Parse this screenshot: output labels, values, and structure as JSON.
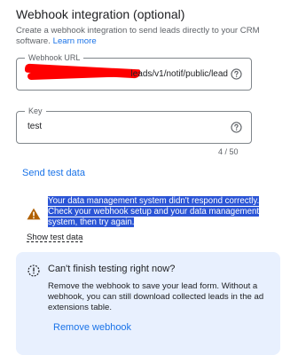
{
  "section": {
    "title": "Webhook integration (optional)",
    "description": "Create a webhook integration to send leads directly to your CRM software.",
    "learn_more": "Learn more"
  },
  "webhook_url": {
    "label": "Webhook URL",
    "value_visible_suffix": "leads/v1/notif/public/lead",
    "help_icon": "help-circle-icon"
  },
  "key": {
    "label": "Key",
    "value": "test",
    "counter": "4 / 50",
    "help_icon": "help-circle-icon"
  },
  "send_test_label": "Send test data",
  "warning": {
    "icon": "warning-triangle-icon",
    "message": "Your data management system didn't respond correctly. Check your webhook setup and your data management system, then try again.",
    "show_test_label": "Show test data"
  },
  "info_card": {
    "icon": "info-dashed-icon",
    "title": "Can't finish testing right now?",
    "body": "Remove the webhook to save your lead form. Without a webhook, you can still download collected leads in the ad extensions table.",
    "remove_label": "Remove webhook"
  },
  "colors": {
    "accent": "#1a73e8",
    "warning": "#b06000",
    "selection": "#2b55d6",
    "card_bg": "#e8f0fe"
  }
}
